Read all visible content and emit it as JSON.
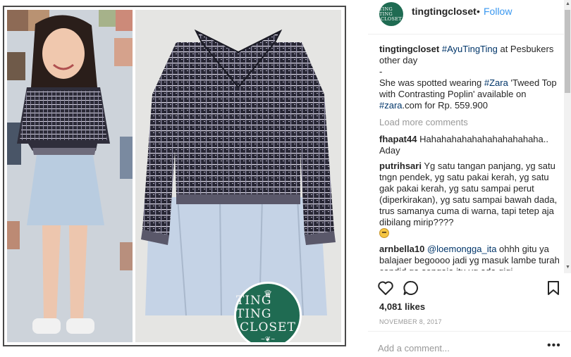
{
  "post": {
    "username": "tingtingcloset",
    "dot": "•",
    "follow_label": "Follow",
    "avatar_text": [
      "TING TING",
      "CLOSET"
    ]
  },
  "logo": {
    "line1": "TING TING",
    "line2": "CLOSET",
    "brand_color": "#1f6b52"
  },
  "caption": {
    "username": "tingtingcloset",
    "hashtag1": "#AyuTingTing",
    "text1": " at Pesbukers other day",
    "dash": "-",
    "text2": "She was spotted wearing ",
    "hashtag2": "#Zara",
    "text3": " 'Tweed Top with Contrasting Poplin' available on ",
    "hashtag3": "#zara",
    "text4": ".com for Rp. 559.900"
  },
  "load_more_label": "Load more comments",
  "comments": [
    {
      "username": "fhapat44",
      "mention": "",
      "text": "Hahahahahahahahahahahaha.. Aday"
    },
    {
      "username": "putrihsari",
      "mention": "",
      "text": "Yg satu tangan panjang, yg satu tngn pendek, yg satu pakai kerah, yg satu gak pakai kerah, yg satu sampai perut (diperkirakan), yg satu sampai bawah dada, trus samanya cuma di warna, tapi tetep aja dibilang mirip????"
    },
    {
      "username": "arnbella10",
      "mention": "@loemongga_ita",
      "text": " ohhh gitu ya balajaer begoooo jadi yg masuk lambe turah candid ga sengaja itu yg ada gigi"
    }
  ],
  "likes": "4,081 likes",
  "date": "NOVEMBER 8, 2017",
  "add_comment_placeholder": "Add a comment...",
  "more_options": "•••",
  "icons": [
    "heart-icon",
    "comment-icon",
    "bookmark-icon",
    "scroll-up-icon",
    "scroll-down-icon"
  ],
  "colors": {
    "link": "#3897f0",
    "hashtag": "#003569",
    "muted": "#999999",
    "text": "#262626"
  }
}
